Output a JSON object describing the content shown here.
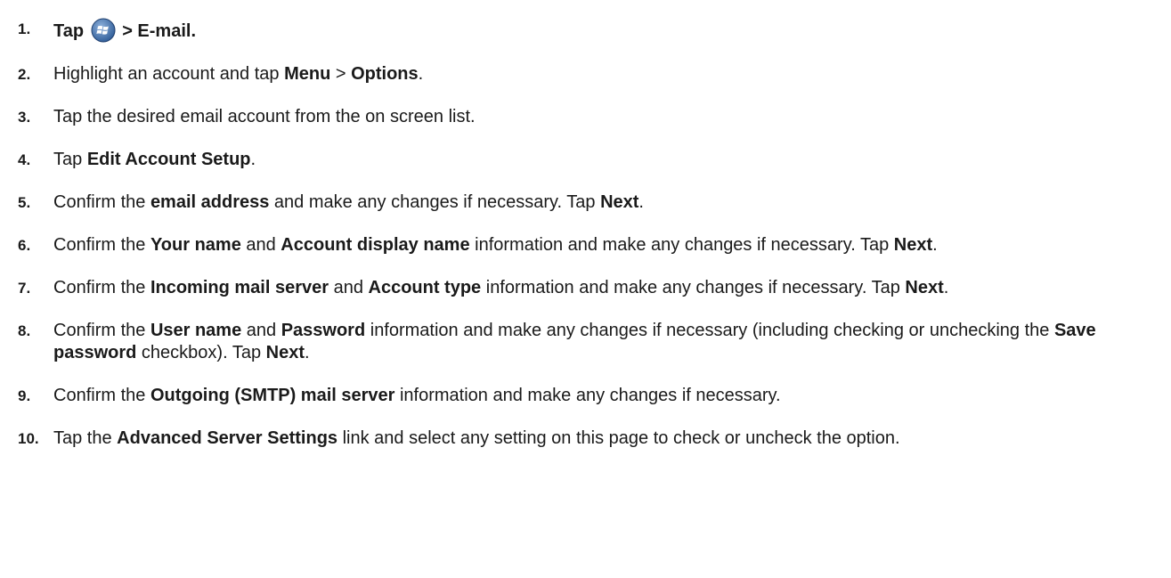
{
  "steps": [
    {
      "num": "1.",
      "parts": [
        {
          "t": "Tap "
        },
        {
          "icon": "windows-start-icon"
        },
        {
          "t": " > E-mail."
        }
      ]
    },
    {
      "num": "2.",
      "parts": [
        {
          "t": "Highlight an account and tap "
        },
        {
          "t": "Menu",
          "b": true
        },
        {
          "t": " > "
        },
        {
          "t": "Options",
          "b": true
        },
        {
          "t": "."
        }
      ]
    },
    {
      "num": "3.",
      "parts": [
        {
          "t": "Tap the desired email account from the on screen list."
        }
      ]
    },
    {
      "num": "4.",
      "parts": [
        {
          "t": "Tap "
        },
        {
          "t": "Edit Account Setup",
          "b": true
        },
        {
          "t": "."
        }
      ]
    },
    {
      "num": "5.",
      "parts": [
        {
          "t": "Confirm the "
        },
        {
          "t": "email address",
          "b": true
        },
        {
          "t": " and make any changes if necessary. Tap "
        },
        {
          "t": "Next",
          "b": true
        },
        {
          "t": "."
        }
      ]
    },
    {
      "num": "6.",
      "parts": [
        {
          "t": "Confirm the "
        },
        {
          "t": "Your name",
          "b": true
        },
        {
          "t": " and "
        },
        {
          "t": "Account display name",
          "b": true
        },
        {
          "t": " information and make any changes if necessary. Tap "
        },
        {
          "t": "Next",
          "b": true
        },
        {
          "t": "."
        }
      ]
    },
    {
      "num": "7.",
      "parts": [
        {
          "t": "Confirm the "
        },
        {
          "t": "Incoming mail server",
          "b": true
        },
        {
          "t": " and "
        },
        {
          "t": "Account type",
          "b": true
        },
        {
          "t": " information and make any changes if necessary. Tap "
        },
        {
          "t": "Next",
          "b": true
        },
        {
          "t": "."
        }
      ]
    },
    {
      "num": "8.",
      "parts": [
        {
          "t": "Confirm the "
        },
        {
          "t": "User name",
          "b": true
        },
        {
          "t": " and "
        },
        {
          "t": "Password",
          "b": true
        },
        {
          "t": " information and make any changes if necessary (including checking or unchecking the "
        },
        {
          "t": "Save password",
          "b": true
        },
        {
          "t": " checkbox). Tap "
        },
        {
          "t": "Next",
          "b": true
        },
        {
          "t": "."
        }
      ]
    },
    {
      "num": "9.",
      "parts": [
        {
          "t": "Confirm the "
        },
        {
          "t": "Outgoing (SMTP) mail server",
          "b": true
        },
        {
          "t": " information and make any changes if necessary."
        }
      ]
    },
    {
      "num": "10.",
      "parts": [
        {
          "t": "Tap the "
        },
        {
          "t": "Advanced Server Settings",
          "b": true
        },
        {
          "t": " link and select any setting on this page to check or uncheck the option."
        }
      ]
    }
  ]
}
